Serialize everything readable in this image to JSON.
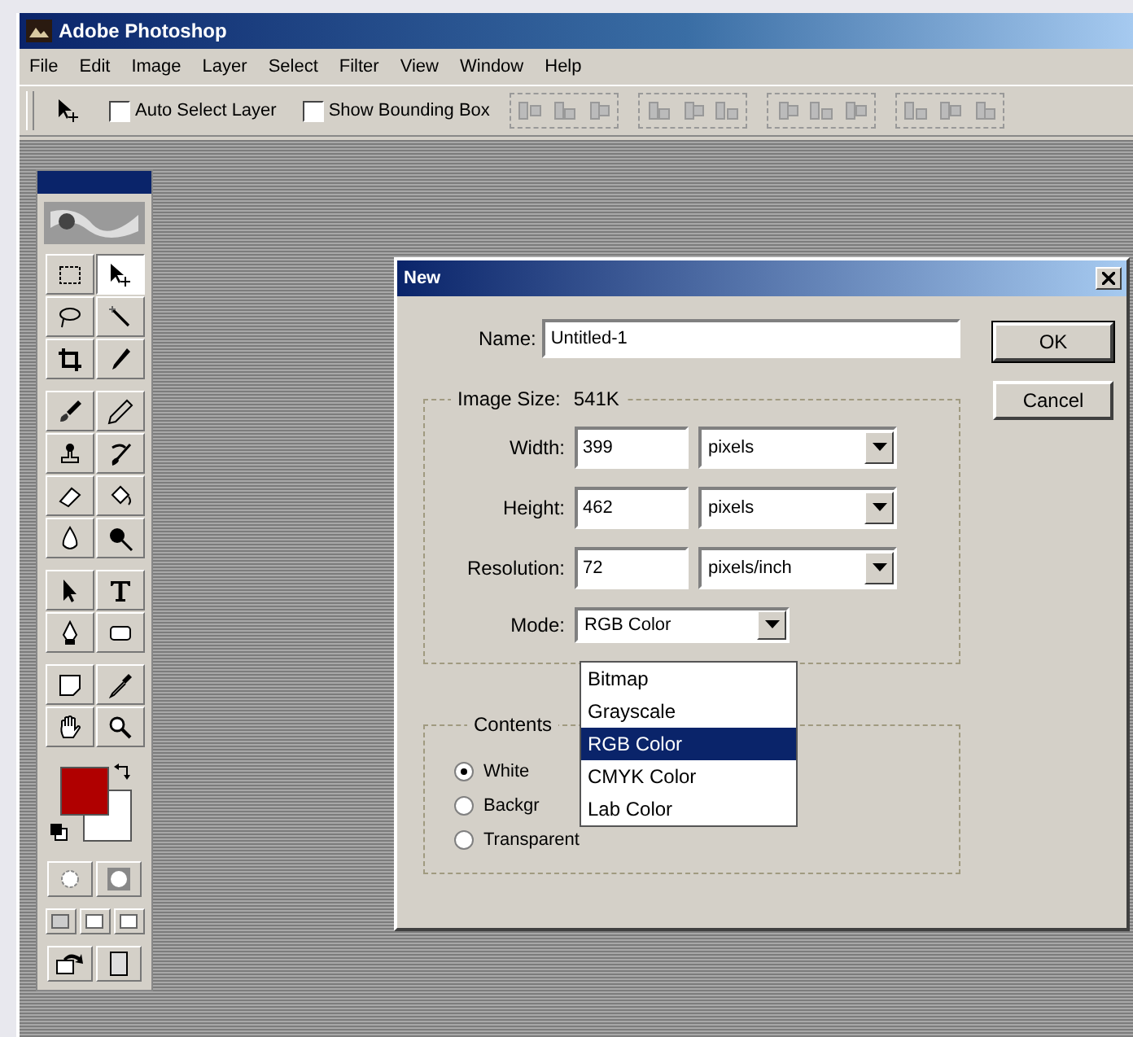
{
  "window": {
    "title": "Adobe Photoshop"
  },
  "menu": [
    "File",
    "Edit",
    "Image",
    "Layer",
    "Select",
    "Filter",
    "View",
    "Window",
    "Help"
  ],
  "options_bar": {
    "checkboxes": [
      {
        "label": "Auto Select Layer",
        "checked": false
      },
      {
        "label": "Show Bounding Box",
        "checked": false
      }
    ]
  },
  "toolbox": {
    "tool_groups": [
      {
        "tools": [
          {
            "selected": false
          },
          {
            "selected": true
          },
          {
            "selected": false
          },
          {
            "selected": false
          },
          {
            "selected": false
          },
          {
            "selected": false
          }
        ]
      },
      {
        "tools": [
          {
            "selected": false
          },
          {
            "selected": false
          },
          {
            "selected": false
          },
          {
            "selected": false
          },
          {
            "selected": false
          },
          {
            "selected": false
          },
          {
            "selected": false
          },
          {
            "selected": false
          }
        ]
      },
      {
        "tools": [
          {
            "selected": false
          },
          {
            "selected": false
          },
          {
            "selected": false
          },
          {
            "selected": false
          }
        ]
      },
      {
        "tools": [
          {
            "selected": false
          },
          {
            "selected": false
          },
          {
            "selected": false
          },
          {
            "selected": false
          }
        ]
      }
    ]
  },
  "dialog": {
    "title": "New",
    "name": {
      "label": "Name:",
      "value": "Untitled-1"
    },
    "image_size": {
      "label": "Image Size:",
      "value": "541K",
      "fields": [
        {
          "label": "Width:",
          "value": "399",
          "unit": "pixels"
        },
        {
          "label": "Height:",
          "value": "462",
          "unit": "pixels"
        },
        {
          "label": "Resolution:",
          "value": "72",
          "unit": "pixels/inch"
        }
      ],
      "mode": {
        "label": "Mode:",
        "value": "RGB Color",
        "options": [
          {
            "label": "Bitmap",
            "selected": false
          },
          {
            "label": "Grayscale",
            "selected": false
          },
          {
            "label": "RGB Color",
            "selected": true
          },
          {
            "label": "CMYK Color",
            "selected": false
          },
          {
            "label": "Lab Color",
            "selected": false
          }
        ]
      }
    },
    "contents": {
      "label": "Contents",
      "options": [
        {
          "label": "White",
          "selected": true
        },
        {
          "label": "Backgr",
          "selected": false
        },
        {
          "label": "Transparent",
          "selected": false
        }
      ]
    },
    "buttons": [
      "OK",
      "Cancel"
    ]
  }
}
